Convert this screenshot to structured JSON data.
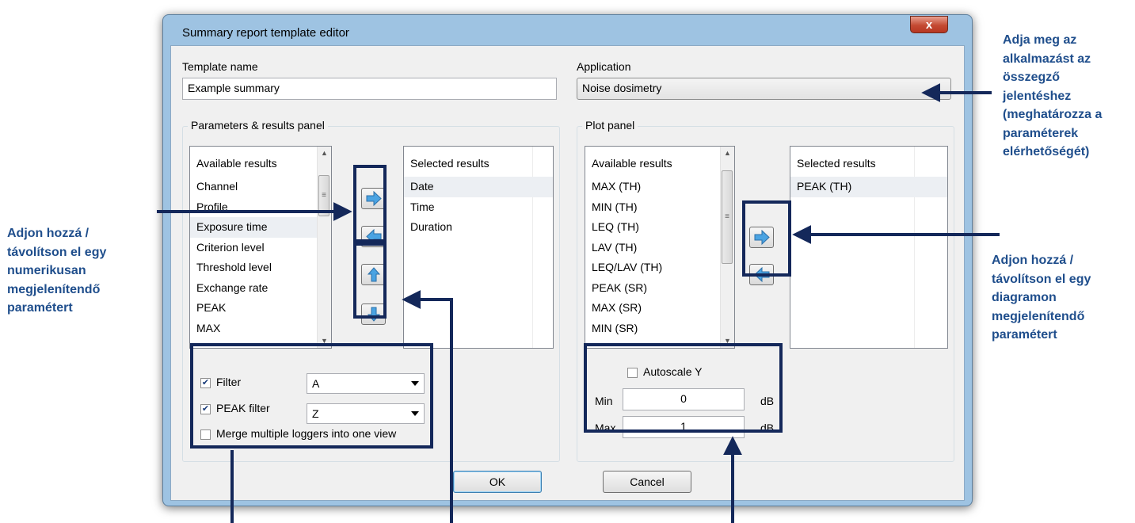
{
  "dialog": {
    "title": "Summary report template editor",
    "close_label": "x",
    "template_name_label": "Template name",
    "template_name_value": "Example summary",
    "application_label": "Application",
    "application_value": "Noise dosimetry",
    "params_panel_title": "Parameters & results panel",
    "plot_panel_title": "Plot panel",
    "params_available": {
      "header": "Available results",
      "items": [
        "Channel",
        "Profile",
        "Exposure time",
        "Criterion level",
        "Threshold level",
        "Exchange rate",
        "PEAK",
        "MAX"
      ]
    },
    "params_selected": {
      "header": "Selected results",
      "items": [
        "Date",
        "Time",
        "Duration"
      ]
    },
    "plot_available": {
      "header": "Available results",
      "items": [
        "MAX (TH)",
        "MIN (TH)",
        "LEQ (TH)",
        "LAV (TH)",
        "LEQ/LAV (TH)",
        "PEAK (SR)",
        "MAX (SR)",
        "MIN (SR)"
      ]
    },
    "plot_selected": {
      "header": "Selected results",
      "items": [
        "PEAK (TH)"
      ]
    },
    "filter": {
      "label": "Filter",
      "checked": true,
      "value": "A"
    },
    "peak_filter": {
      "label": "PEAK filter",
      "checked": true,
      "value": "Z"
    },
    "merge": {
      "label": "Merge multiple loggers into one view",
      "checked": false
    },
    "autoscale": {
      "label": "Autoscale Y",
      "checked": false
    },
    "min": {
      "label": "Min",
      "value": "0",
      "unit": "dB"
    },
    "max": {
      "label": "Max",
      "value": "1",
      "unit": "dB"
    },
    "ok_label": "OK",
    "cancel_label": "Cancel"
  },
  "annotations": {
    "application_note": [
      "Adja meg az",
      "alkalmazást az",
      "összegző",
      "jelentéshez",
      "(meghatározza a",
      "paraméterek",
      "elérhetőségét)"
    ],
    "params_note": [
      "Adjon hozzá /",
      "távolítson el egy",
      "numerikusan",
      "megjelenítendő",
      "paramétert"
    ],
    "plot_note": [
      "Adjon hozzá /",
      "távolítson el egy",
      "diagramon",
      "megjelenítendő",
      "paramétert"
    ],
    "color": "#1f4e8c",
    "frame_color": "#14285a"
  },
  "icons": {
    "arrow_right": "arrow-right-icon",
    "arrow_left": "arrow-left-icon",
    "arrow_up": "arrow-up-icon",
    "arrow_down": "arrow-down-icon"
  }
}
